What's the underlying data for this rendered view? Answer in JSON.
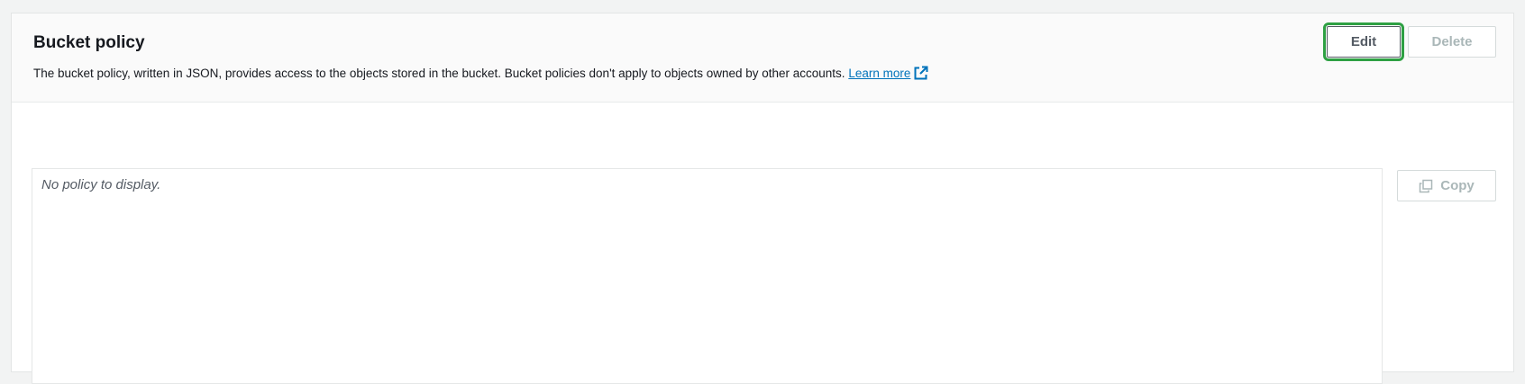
{
  "section": {
    "title": "Bucket policy",
    "description": "The bucket policy, written in JSON, provides access to the objects stored in the bucket. Bucket policies don't apply to objects owned by other accounts.",
    "learn_more": "Learn more"
  },
  "actions": {
    "edit_label": "Edit",
    "delete_label": "Delete",
    "copy_label": "Copy"
  },
  "policy": {
    "empty_text": "No policy to display."
  },
  "colors": {
    "link": "#0073bb",
    "focus_ring": "#2ea043",
    "disabled_text": "#aab7b8"
  },
  "icons": {
    "learn_more": "external-link-icon",
    "copy": "copy-icon"
  }
}
